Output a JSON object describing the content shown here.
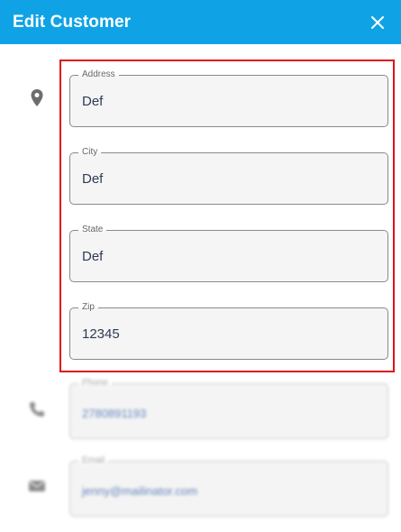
{
  "header": {
    "title": "Edit Customer",
    "close_icon": "close-icon",
    "background": "#0fa3e6"
  },
  "highlight_color": "#e0121b",
  "address_section": {
    "icon": "location-pin-icon",
    "fields": [
      {
        "label": "Address",
        "value": "Def"
      },
      {
        "label": "City",
        "value": "Def"
      },
      {
        "label": "State",
        "value": "Def"
      },
      {
        "label": "Zip",
        "value": "12345"
      }
    ]
  },
  "phone_section": {
    "icon": "phone-icon",
    "label": "Phone",
    "value": "2780891193"
  },
  "email_section": {
    "icon": "email-icon",
    "label": "Email",
    "value": "jenny@mailinator.com"
  }
}
